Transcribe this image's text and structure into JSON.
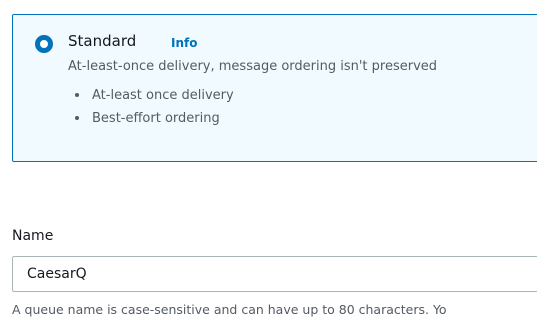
{
  "queue_type": {
    "selected_option": {
      "title": "Standard",
      "info_link": "Info",
      "description": "At-least-once delivery, message ordering isn't preserved",
      "features": [
        "At-least once delivery",
        "Best-effort ordering"
      ]
    }
  },
  "name_field": {
    "label": "Name",
    "value": "CaesarQ",
    "constraint_text": "A queue name is case-sensitive and can have up to 80 characters. Yo"
  },
  "colors": {
    "accent": "#0073bb",
    "tile_background": "#f1faff",
    "text_primary": "#16191f",
    "text_secondary": "#545b64",
    "input_border": "#aab7b8"
  }
}
